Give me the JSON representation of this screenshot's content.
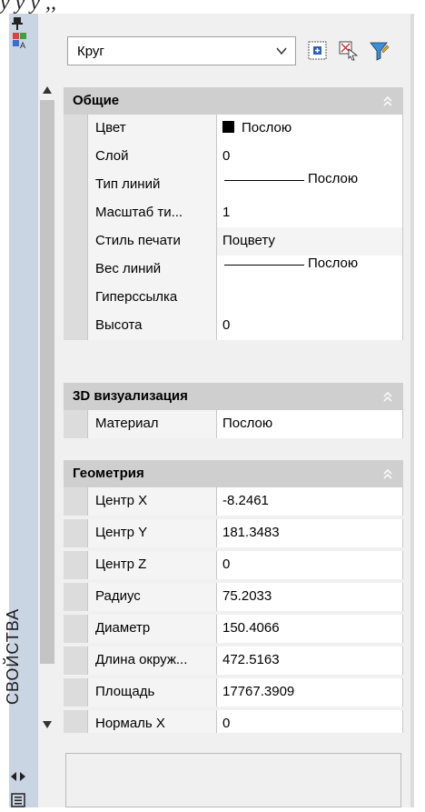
{
  "doc": {
    "fragment": "у у у ,,"
  },
  "strip": {
    "title": "СВОЙСТВА"
  },
  "header": {
    "object_type": "Круг"
  },
  "sections": [
    {
      "title": "Общие",
      "rows": [
        {
          "name": "Цвет",
          "value": "Послою"
        },
        {
          "name": "Слой",
          "value": "0"
        },
        {
          "name": "Тип линий",
          "value": "Послою"
        },
        {
          "name": "Масштаб ти...",
          "value": "1"
        },
        {
          "name": "Стиль печати",
          "value": "Поцвету"
        },
        {
          "name": "Вес линий",
          "value": "Послою"
        },
        {
          "name": "Гиперссылка",
          "value": ""
        },
        {
          "name": "Высота",
          "value": "0"
        }
      ]
    },
    {
      "title": "3D визуализация",
      "rows": [
        {
          "name": "Материал",
          "value": "Послою"
        }
      ]
    },
    {
      "title": "Геометрия",
      "rows": [
        {
          "name": "Центр X",
          "value": "-8.2461"
        },
        {
          "name": "Центр Y",
          "value": "181.3483"
        },
        {
          "name": "Центр Z",
          "value": "0"
        },
        {
          "name": "Радиус",
          "value": "75.2033"
        },
        {
          "name": "Диаметр",
          "value": "150.4066"
        },
        {
          "name": "Длина окруж...",
          "value": "472.5163"
        },
        {
          "name": "Площадь",
          "value": "17767.3909"
        },
        {
          "name": "Нормаль X",
          "value": "0"
        }
      ]
    }
  ],
  "icons": {
    "pin": "pin-icon",
    "properties": "properties-icon",
    "quick_select": "quick-select-icon",
    "select_objects": "select-objects-icon",
    "toggle_pickadd": "toggle-pickadd-icon",
    "collapse": "collapse-section-icon",
    "dropdown": "chevron-down-icon",
    "resize": "resize-icon",
    "menu": "menu-icon"
  },
  "colors": {
    "strip": "#c9d5e3",
    "section_header": "#cfcfcf",
    "color_swatch": "#000000"
  }
}
